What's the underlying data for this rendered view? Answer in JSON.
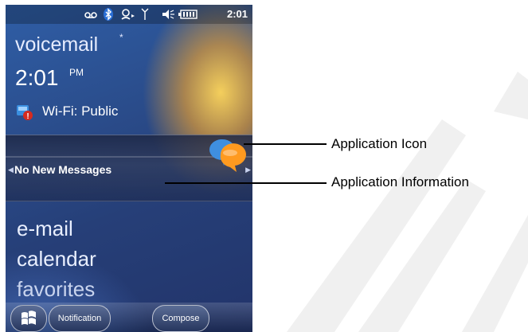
{
  "status_bar": {
    "time": "2:01",
    "icons": [
      "voicemail-icon",
      "bluetooth-icon",
      "sync-icon",
      "signal-icon",
      "speaker-icon",
      "battery-icon"
    ]
  },
  "lock_screen": {
    "voicemail_label": "voicemail",
    "voicemail_marker": "*",
    "time": "2:01",
    "ampm": "PM",
    "wifi_status": "Wi-Fi: Public",
    "notification_text": "No New Messages",
    "menu": [
      "e-mail",
      "calendar",
      "favorites"
    ]
  },
  "softkeys": {
    "left": "Notification",
    "right": "Compose"
  },
  "callouts": {
    "app_icon": "Application Icon",
    "app_info": "Application Information"
  },
  "colors": {
    "accent_orange": "#ff9a1f",
    "bubble_blue": "#3f8fe0",
    "screen_blue": "#2b4f8f"
  }
}
